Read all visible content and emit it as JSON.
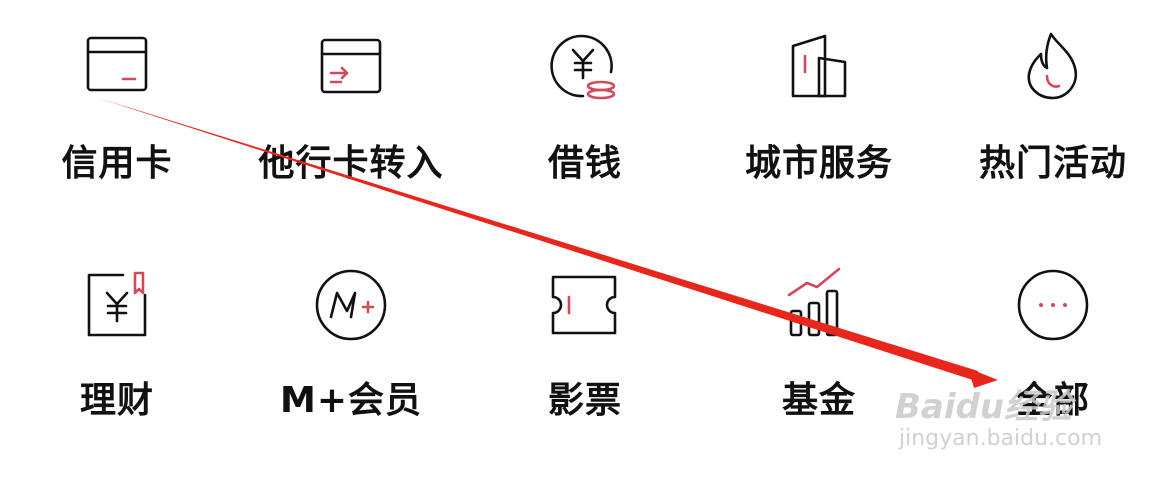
{
  "colors": {
    "stroke": "#111111",
    "accent": "#d24a5a",
    "arrow": "#e8261c",
    "watermark": "#c9c9c9"
  },
  "menu": {
    "items": [
      {
        "label": "信用卡",
        "icon": "credit-card-icon"
      },
      {
        "label": "他行卡转入",
        "icon": "card-transfer-in-icon"
      },
      {
        "label": "借钱",
        "icon": "yuan-coin-icon"
      },
      {
        "label": "城市服务",
        "icon": "city-buildings-icon"
      },
      {
        "label": "热门活动",
        "icon": "flame-icon"
      },
      {
        "label": "理财",
        "icon": "yuan-bookmark-icon"
      },
      {
        "label": "M+会员",
        "icon": "m-plus-icon"
      },
      {
        "label": "影票",
        "icon": "ticket-icon"
      },
      {
        "label": "基金",
        "icon": "rising-bars-icon"
      },
      {
        "label": "全部",
        "icon": "more-dots-icon"
      }
    ]
  },
  "watermark": {
    "brand": "Baidu经验",
    "url": "jingyan.baidu.com"
  }
}
